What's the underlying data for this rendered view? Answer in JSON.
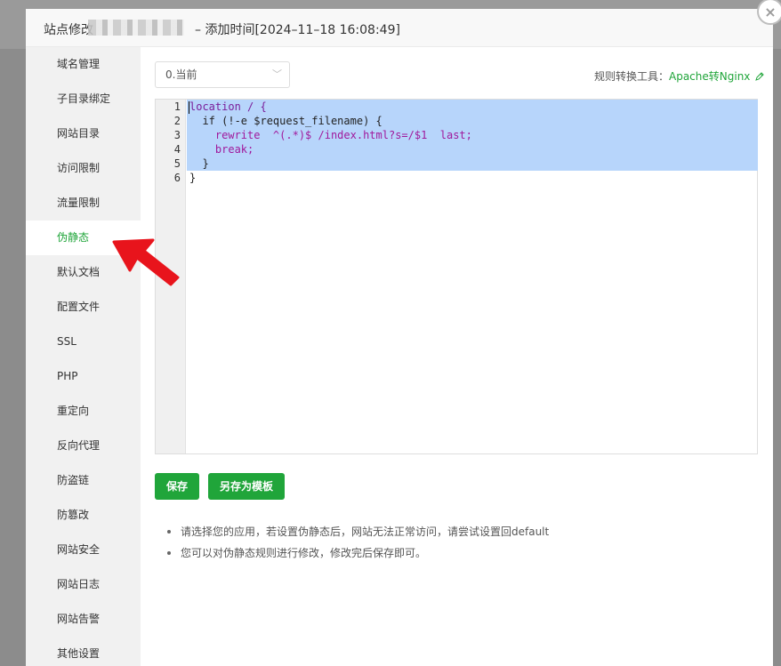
{
  "modal": {
    "title_prefix": "站点修改",
    "title_suffix": "– 添加时间[2024–11–18 16:08:49]",
    "close_label": "×"
  },
  "sidebar": {
    "items": [
      {
        "label": "域名管理"
      },
      {
        "label": "子目录绑定"
      },
      {
        "label": "网站目录"
      },
      {
        "label": "访问限制"
      },
      {
        "label": "流量限制"
      },
      {
        "label": "伪静态",
        "active": true
      },
      {
        "label": "默认文档"
      },
      {
        "label": "配置文件"
      },
      {
        "label": "SSL"
      },
      {
        "label": "PHP"
      },
      {
        "label": "重定向"
      },
      {
        "label": "反向代理"
      },
      {
        "label": "防盗链"
      },
      {
        "label": "防篡改"
      },
      {
        "label": "网站安全"
      },
      {
        "label": "网站日志"
      },
      {
        "label": "网站告警"
      },
      {
        "label": "其他设置"
      }
    ]
  },
  "rewrite": {
    "template_select": "0.当前",
    "tool_label": "规则转换工具：",
    "tool_link": "Apache转Nginx",
    "tool_icon": "edit-icon",
    "line_numbers": [
      "1",
      "2",
      "3",
      "4",
      "5",
      "6"
    ],
    "code_lines": [
      "location / {",
      "  if (!-e $request_filename) {",
      "    rewrite  ^(.*)$ /index.html?s=/$1  last;",
      "    break;",
      "  }",
      "}"
    ],
    "save_button": "保存",
    "save_template_button": "另存为模板",
    "tips": [
      "请选择您的应用，若设置伪静态后，网站无法正常访问，请尝试设置回default",
      "您可以对伪静态规则进行修改，修改完后保存即可。"
    ]
  },
  "colors": {
    "accent": "#20a53a",
    "selection": "#b7d5fb",
    "annotation_arrow": "#e8141c"
  }
}
